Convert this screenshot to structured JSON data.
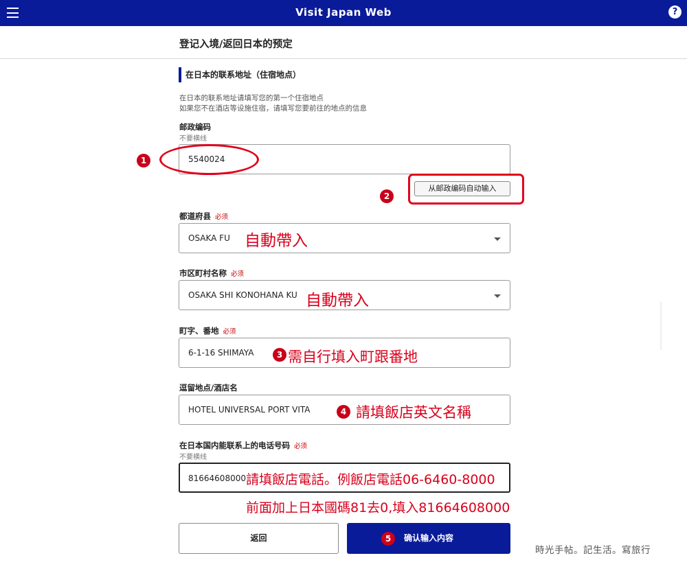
{
  "header": {
    "app_title": "Visit Japan Web",
    "menu_icon": "hamburger-menu-icon",
    "help_icon": "help-icon",
    "help_glyph": "?"
  },
  "page": {
    "title": "登记入境/返回日本的预定"
  },
  "section": {
    "title": "在日本的联系地址（住宿地点）",
    "desc_line1": "在日本的联系地址请填写您的第一个住宿地点",
    "desc_line2": "如果您不在酒店等设施住宿，请填写您要前往的地点的信息"
  },
  "fields": {
    "postal": {
      "label": "邮政编码",
      "hint": "不要横线",
      "value": "5540024"
    },
    "auto_fill_button": "从邮政编码自动输入",
    "prefecture": {
      "label": "都道府县",
      "required": "必须",
      "value": "OSAKA FU"
    },
    "city": {
      "label": "市区町村名称",
      "required": "必须",
      "value": "OSAKA SHI KONOHANA KU"
    },
    "address": {
      "label": "町字、番地",
      "required": "必须",
      "value": "6-1-16 SHIMAYA"
    },
    "hotel": {
      "label": "逗留地点/酒店名",
      "value": "HOTEL UNIVERSAL PORT VITA"
    },
    "phone": {
      "label": "在日本国内能联系上的电话号码",
      "required": "必须",
      "hint": "不要横线",
      "value": "81664608000"
    }
  },
  "buttons": {
    "back": "返回",
    "confirm": "确认输入内容"
  },
  "annotations": {
    "badge1": "1",
    "badge2": "2",
    "badge3": "3",
    "badge4": "4",
    "badge5": "5",
    "auto_prefecture": "自動帶入",
    "auto_city": "自動帶入",
    "address_note": "需自行填入町跟番地",
    "hotel_note": "請填飯店英文名稱",
    "phone_note1": "請填飯店電話。例飯店電話06-6460-8000",
    "phone_note2": "前面加上日本國碼81去0,填入81664608000",
    "color": "#d8001c"
  },
  "watermark": "時光手帖。記生活。寫旅行"
}
